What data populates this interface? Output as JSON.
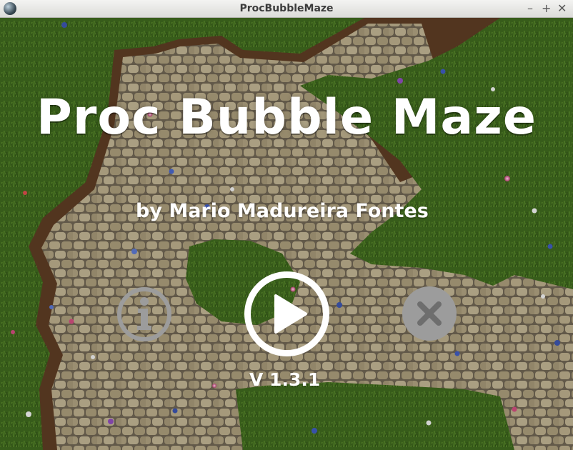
{
  "window": {
    "title": "ProcBubbleMaze",
    "minimize_glyph": "–",
    "maximize_glyph": "+",
    "close_glyph": "✕"
  },
  "menu": {
    "game_title": "Proc Bubble Maze",
    "author": "by Mario Madureira Fontes",
    "version": "V 1.3.1",
    "buttons": {
      "info_icon": "info-icon",
      "play_icon": "play-icon",
      "exit_icon": "close-icon"
    }
  },
  "colors": {
    "grass": "#3f6a1f",
    "stone": "#a59a7c",
    "button_white": "#ffffff",
    "button_grey": "#9c9c9c"
  }
}
